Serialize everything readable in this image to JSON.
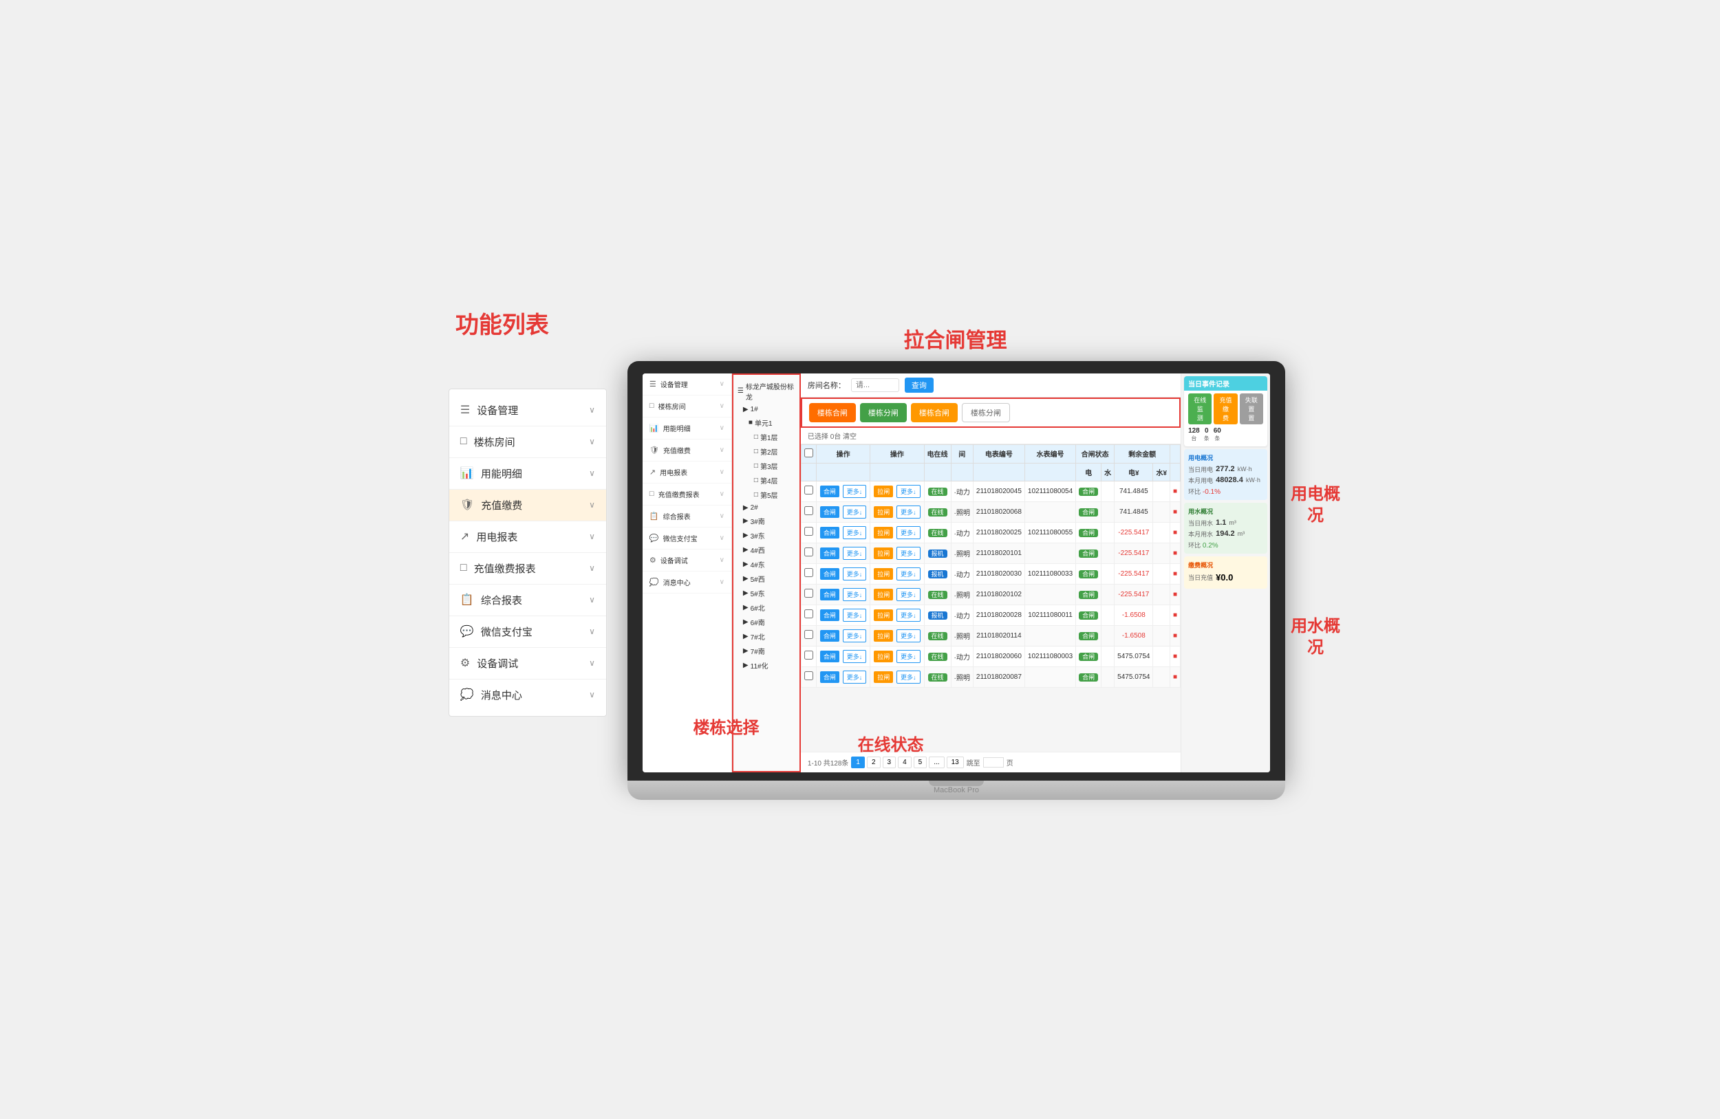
{
  "annotations": {
    "gongneng": "功能列表",
    "lahe": "拉合闸管理",
    "yongdian": "用电概\n况",
    "yongshui": "用水概\n况",
    "louzhan": "楼栋选择",
    "zaixian": "在线状态"
  },
  "sidebar": {
    "items": [
      {
        "icon": "☰",
        "label": "设备管理",
        "arrow": "∨"
      },
      {
        "icon": "□",
        "label": "楼栋房间",
        "arrow": "∨"
      },
      {
        "icon": "📊",
        "label": "用能明细",
        "arrow": "∨"
      },
      {
        "icon": "🛡",
        "label": "充值缴费",
        "arrow": "∨",
        "active": true
      },
      {
        "icon": "↗",
        "label": "用电报表",
        "arrow": "∨"
      },
      {
        "icon": "□",
        "label": "充值缴费报表",
        "arrow": "∨"
      },
      {
        "icon": "📋",
        "label": "综合报表",
        "arrow": "∨"
      },
      {
        "icon": "💬",
        "label": "微信支付宝",
        "arrow": "∨"
      },
      {
        "icon": "⚙",
        "label": "设备调试",
        "arrow": "∨"
      },
      {
        "icon": "💭",
        "label": "消息中心",
        "arrow": "∨"
      }
    ]
  },
  "app_sidebar": {
    "items": [
      {
        "icon": "☰",
        "label": "设备管理",
        "arrow": "∨"
      },
      {
        "icon": "□",
        "label": "楼栋房间",
        "arrow": "∨"
      },
      {
        "icon": "📊",
        "label": "用能明细",
        "arrow": "∨"
      },
      {
        "icon": "🛡",
        "label": "充值缴费",
        "arrow": "∨"
      },
      {
        "icon": "↗",
        "label": "用电报表",
        "arrow": "∨"
      },
      {
        "icon": "□",
        "label": "充值缴费报表",
        "arrow": "∨"
      },
      {
        "icon": "📋",
        "label": "综合报表",
        "arrow": "∨"
      },
      {
        "icon": "💬",
        "label": "微信支付宝",
        "arrow": "∨"
      },
      {
        "icon": "⚙",
        "label": "设备调试",
        "arrow": "∨"
      },
      {
        "icon": "💭",
        "label": "消息中心",
        "arrow": "∨"
      }
    ]
  },
  "building_tree": {
    "items": [
      {
        "indent": 0,
        "icon": "☰",
        "label": "标龙产城股份标龙"
      },
      {
        "indent": 1,
        "icon": "▶",
        "label": "1#"
      },
      {
        "indent": 2,
        "icon": "■",
        "label": "单元1"
      },
      {
        "indent": 3,
        "icon": "□",
        "label": "第1层"
      },
      {
        "indent": 3,
        "icon": "□",
        "label": "第2层"
      },
      {
        "indent": 3,
        "icon": "□",
        "label": "第3层"
      },
      {
        "indent": 3,
        "icon": "□",
        "label": "第4层"
      },
      {
        "indent": 3,
        "icon": "□",
        "label": "第5层"
      },
      {
        "indent": 1,
        "icon": "▶",
        "label": "2#"
      },
      {
        "indent": 1,
        "icon": "▶",
        "label": "3#南"
      },
      {
        "indent": 1,
        "icon": "▶",
        "label": "3#东"
      },
      {
        "indent": 1,
        "icon": "▶",
        "label": "4#西"
      },
      {
        "indent": 1,
        "icon": "▶",
        "label": "4#东"
      },
      {
        "indent": 1,
        "icon": "▶",
        "label": "5#西"
      },
      {
        "indent": 1,
        "icon": "▶",
        "label": "5#东"
      },
      {
        "indent": 1,
        "icon": "▶",
        "label": "6#北"
      },
      {
        "indent": 1,
        "icon": "▶",
        "label": "6#南"
      },
      {
        "indent": 1,
        "icon": "▶",
        "label": "7#北"
      },
      {
        "indent": 1,
        "icon": "▶",
        "label": "7#南"
      },
      {
        "indent": 1,
        "icon": "▶",
        "label": "11#化"
      }
    ]
  },
  "header": {
    "room_name_label": "房间名称：",
    "search_placeholder": "请...",
    "search_btn": "查询"
  },
  "gate_buttons": [
    {
      "label": "楼栋合闸",
      "type": "orange"
    },
    {
      "label": "楼栋分闸",
      "type": "green"
    },
    {
      "label": "楼栋合闸",
      "type": "orange2"
    },
    {
      "label": "楼栋分闸",
      "type": "gray"
    }
  ],
  "selected_info": "已选择 0台  清空",
  "table": {
    "headers": [
      "操作",
      "操作",
      "电在线",
      "间",
      "电表编号",
      "水表编号",
      "合闸状态电",
      "合闸状态电¥",
      "合闸状态水¥",
      "剩余金额电",
      "剩余金额电¥",
      "剩余金额水¥"
    ],
    "rows": [
      {
        "op1": "合闸",
        "op2": "更多↓",
        "op3": "拉闸",
        "op4": "更多↓",
        "online": "在线",
        "room": "·动力",
        "meter_e": "211018020045",
        "meter_w": "102111080054",
        "gate_e": "合闸",
        "balance": "741.4845",
        "alert": "■"
      },
      {
        "op1": "合闸",
        "op2": "更多↓",
        "op3": "拉闸",
        "op4": "更多↓",
        "online": "在线",
        "room": "·照明",
        "meter_e": "211018020068",
        "meter_w": "",
        "gate_e": "合闸",
        "balance": "741.4845",
        "alert": "■"
      },
      {
        "op1": "合闸",
        "op2": "更多↓",
        "op3": "拉闸",
        "op4": "更多↓",
        "online": "在线",
        "room": "·动力",
        "meter_e": "211018020025",
        "meter_w": "102111080055",
        "gate_e": "合闸",
        "balance": "-225.5417",
        "alert": "■"
      },
      {
        "op1": "合闸",
        "op2": "更多↓",
        "op3": "拉闸",
        "op4": "更多↓",
        "online": "报机",
        "room": "·照明",
        "meter_e": "211018020101",
        "meter_w": "",
        "gate_e": "合闸",
        "balance": "-225.5417",
        "alert": "■"
      },
      {
        "op1": "合闸",
        "op2": "更多↓",
        "op3": "拉闸",
        "op4": "更多↓",
        "online": "报机",
        "room": "·动力",
        "meter_e": "211018020030",
        "meter_w": "102111080033",
        "gate_e": "合闸",
        "balance": "-225.5417",
        "alert": "■"
      },
      {
        "op1": "合闸",
        "op2": "更多↓",
        "op3": "拉闸",
        "op4": "更多↓",
        "online": "在线",
        "room": "·照明",
        "meter_e": "211018020102",
        "meter_w": "",
        "gate_e": "合闸",
        "balance": "-225.5417",
        "alert": "■"
      },
      {
        "op1": "合闸",
        "op2": "更多↓",
        "op3": "拉闸",
        "op4": "更多↓",
        "online": "报机",
        "room": "·动力",
        "meter_e": "211018020028",
        "meter_w": "102111080011",
        "gate_e": "合闸",
        "balance": "-1.6508",
        "alert": "■"
      },
      {
        "op1": "合闸",
        "op2": "更多↓",
        "op3": "拉闸",
        "op4": "更多↓",
        "online": "在线",
        "room": "·照明",
        "meter_e": "211018020114",
        "meter_w": "",
        "gate_e": "合闸",
        "balance": "-1.6508",
        "alert": "■"
      },
      {
        "op1": "合闸",
        "op2": "更多↓",
        "op3": "拉闸",
        "op4": "更多↓",
        "online": "在线",
        "room": "·动力",
        "meter_e": "211018020060",
        "meter_w": "102111080003",
        "gate_e": "合闸",
        "balance": "5475.0754",
        "alert": "■"
      },
      {
        "op1": "合闸",
        "op2": "更多↓",
        "op3": "拉闸",
        "op4": "更多↓",
        "online": "在线",
        "room": "·照明",
        "meter_e": "211018020087",
        "meter_w": "",
        "gate_e": "合闸",
        "balance": "5475.0754",
        "alert": "■"
      }
    ]
  },
  "pagination": {
    "info": "1-10 共128条",
    "pages": [
      "1",
      "2",
      "3",
      "4",
      "5",
      "...",
      "13"
    ],
    "goto_label": "跳至",
    "goto_suffix": "页",
    "current": "1"
  },
  "right_panel": {
    "event_header": "当日事件记录",
    "event_badges": [
      {
        "label": "在线监\n测",
        "type": "eb-online"
      },
      {
        "label": "充值缴\n费",
        "type": "eb-charge"
      },
      {
        "label": "失联置\n置",
        "type": "eb-offline"
      }
    ],
    "event_stats": [
      {
        "num": "128",
        "label": "台"
      },
      {
        "num": "0",
        "label": "条"
      },
      {
        "num": "60",
        "label": "条"
      }
    ],
    "electricity": {
      "header": "用电概况",
      "today_label": "当日用电",
      "today_value": "277.2",
      "today_unit": "kW·h",
      "month_label": "本月用电",
      "month_value": "48028.4",
      "month_unit": "kW·h",
      "change_label": "环比",
      "change_value": "-0.1%"
    },
    "water": {
      "header": "用水概况",
      "today_label": "当日用水",
      "today_value": "1.1",
      "today_unit": "m³",
      "month_label": "本月用水",
      "month_value": "194.2",
      "month_unit": "m³",
      "change_label": "环比",
      "change_value": "0.2%"
    },
    "charge": {
      "header": "缴费概况",
      "today_label": "当日充值",
      "today_value": "¥0.0"
    }
  }
}
